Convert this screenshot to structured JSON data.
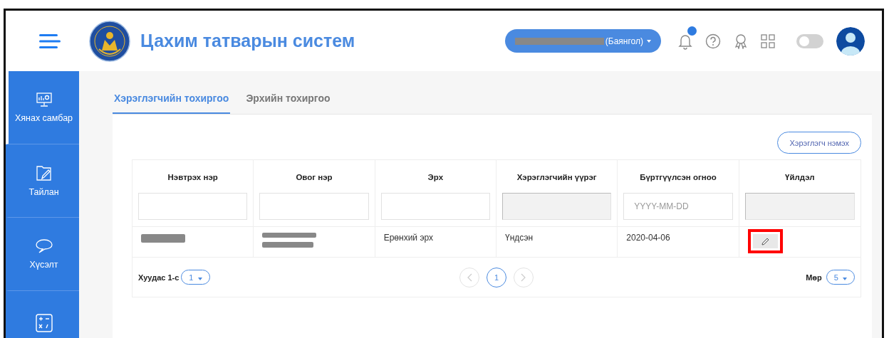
{
  "header": {
    "title": "Цахим татварын систем",
    "account": {
      "suffix": "(Баянгол)",
      "redacted": true
    },
    "toggle": {
      "on": false
    }
  },
  "sidebar": {
    "items": [
      {
        "label": "Хянах самбар",
        "selected": true
      },
      {
        "label": "Тайлан",
        "selected": false
      },
      {
        "label": "Хүсэлт",
        "selected": false
      },
      {
        "selected": false
      }
    ]
  },
  "tabs": [
    {
      "label": "Хэрэглэгчийн тохиргоо",
      "selected": true
    },
    {
      "label": "Эрхийн тохиргоо",
      "selected": false
    }
  ],
  "add_button": "Хэрэглэгч нэмэх",
  "table": {
    "columns": [
      {
        "label": "Нэвтрэх нэр",
        "filter_disabled": false
      },
      {
        "label": "Овог нэр",
        "filter_disabled": false
      },
      {
        "label": "Эрх",
        "filter_disabled": false
      },
      {
        "label": "Хэрэглэгчийн үүрэг",
        "filter_disabled": true
      },
      {
        "label": "Бүртгүүлсэн огноо",
        "filter_disabled": false,
        "placeholder": "YYYY-MM-DD"
      },
      {
        "label": "Үйлдэл",
        "filter_disabled": true
      }
    ],
    "rows": [
      {
        "cells": [
          {
            "kind": "redacted"
          },
          {
            "kind": "redacted2"
          },
          {
            "kind": "text",
            "text": "Ерөнхий эрх"
          },
          {
            "kind": "text",
            "text": "Үндсэн"
          },
          {
            "kind": "text",
            "text": "2020-04-06"
          },
          {
            "kind": "edit",
            "highlighted": true
          }
        ]
      }
    ]
  },
  "pager": {
    "page_label": "Хуудас 1-с",
    "page_select": "1",
    "pages": [
      {
        "label": "1",
        "selected": true
      }
    ],
    "rows_label": "Мөр",
    "rows_select": "5"
  }
}
